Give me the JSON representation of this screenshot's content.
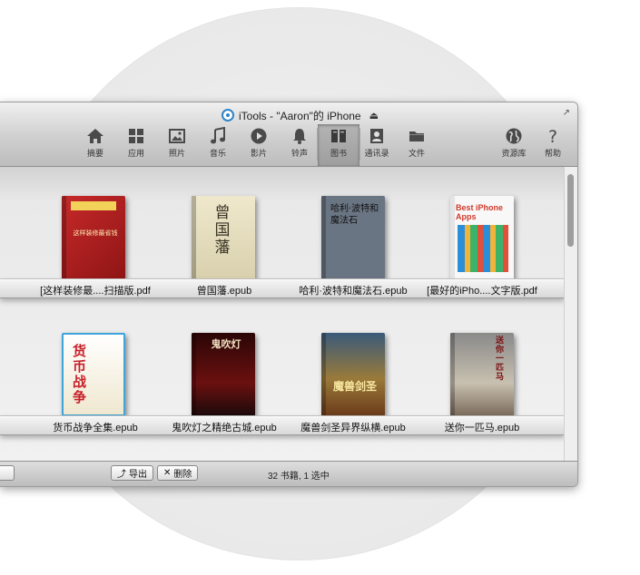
{
  "window": {
    "title": "iTools - \"Aaron\"的 iPhone",
    "eject_icon": "eject-icon"
  },
  "toolbar": [
    {
      "id": "summary",
      "label": "摘要",
      "icon": "home-icon"
    },
    {
      "id": "apps",
      "label": "应用",
      "icon": "apps-icon"
    },
    {
      "id": "photos",
      "label": "照片",
      "icon": "photo-icon"
    },
    {
      "id": "music",
      "label": "音乐",
      "icon": "music-icon"
    },
    {
      "id": "video",
      "label": "影片",
      "icon": "play-icon"
    },
    {
      "id": "ringtones",
      "label": "铃声",
      "icon": "bell-icon"
    },
    {
      "id": "books",
      "label": "图书",
      "icon": "book-icon",
      "active": true
    },
    {
      "id": "contacts",
      "label": "通讯录",
      "icon": "contacts-icon"
    },
    {
      "id": "files",
      "label": "文件",
      "icon": "folder-icon"
    },
    {
      "id": "library",
      "label": "资源库",
      "icon": "globe-icon"
    },
    {
      "id": "help",
      "label": "帮助",
      "icon": "help-icon"
    }
  ],
  "books": [
    {
      "title": "[这样装修最....扫描版.pdf",
      "cover_text": "这样装修最省钱"
    },
    {
      "title": "曾国藩.epub",
      "cover_text": "曾国藩"
    },
    {
      "title": "哈利·波特和魔法石.epub",
      "cover_text": "哈利·波特和魔法石"
    },
    {
      "title": "[最好的iPho....文字版.pdf",
      "cover_text": "Best iPhone Apps"
    },
    {
      "title": "货币战争全集.epub",
      "cover_text": "货币战争"
    },
    {
      "title": "鬼吹灯之精绝古城.epub",
      "cover_text": "鬼吹灯"
    },
    {
      "title": "魔兽剑圣异界纵横.epub",
      "cover_text": "魔兽剑圣"
    },
    {
      "title": "送你一匹马.epub",
      "cover_text": "送你一匹马"
    }
  ],
  "bottombar": {
    "export_label": "导出",
    "delete_label": "删除",
    "status": "32 书籍, 1 选中"
  },
  "colors": {
    "accent": "#2d84c9",
    "toolbar_active": "#a8a8a8"
  }
}
